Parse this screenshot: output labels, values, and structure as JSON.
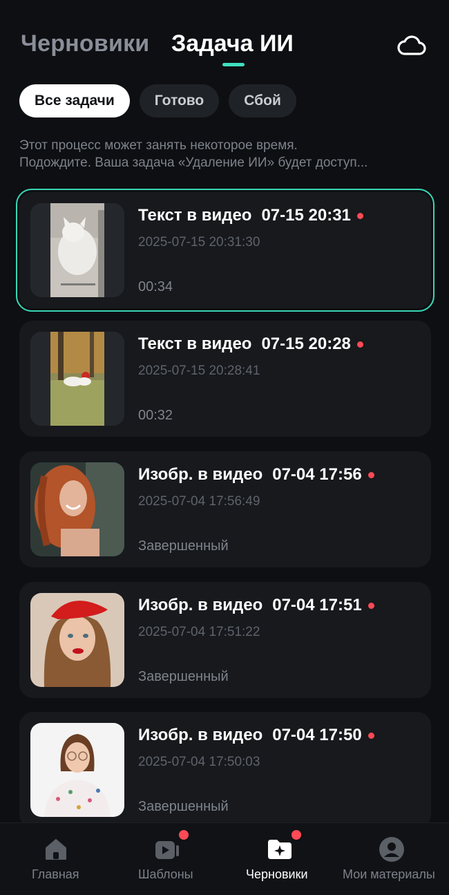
{
  "header": {
    "tab_drafts": "Черновики",
    "tab_ai_task": "Задача ИИ",
    "accent_color": "#3fe0c0"
  },
  "filters": {
    "all": "Все задачи",
    "done": "Готово",
    "failed": "Сбой"
  },
  "notice": {
    "line1": "Этот процесс может занять некоторое время.",
    "line2": "Подождите. Ваша задача «Удаление ИИ» будет доступ..."
  },
  "tasks": [
    {
      "type": "Текст в видео",
      "short_time": "07-15 20:31",
      "datetime": "2025-07-15 20:31:30",
      "meta": "00:34",
      "thumb": "cat-video",
      "unread": true
    },
    {
      "type": "Текст в видео",
      "short_time": "07-15 20:28",
      "datetime": "2025-07-15 20:28:41",
      "meta": "00:32",
      "thumb": "park-video",
      "unread": true
    },
    {
      "type": "Изобр. в видео",
      "short_time": "07-04 17:56",
      "datetime": "2025-07-04 17:56:49",
      "meta": "Завершенный",
      "thumb": "redhead-woman-photo",
      "unread": true
    },
    {
      "type": "Изобр. в видео",
      "short_time": "07-04 17:51",
      "datetime": "2025-07-04 17:51:22",
      "meta": "Завершенный",
      "thumb": "beret-woman-photo",
      "unread": true
    },
    {
      "type": "Изобр. в видео",
      "short_time": "07-04 17:50",
      "datetime": "2025-07-04 17:50:03",
      "meta": "Завершенный",
      "thumb": "glasses-woman-photo",
      "unread": true
    }
  ],
  "nav": {
    "home": "Главная",
    "templates": "Шаблоны",
    "drafts": "Черновики",
    "materials": "Мои материалы"
  },
  "colors": {
    "background": "#0d0f12",
    "card": "#17191d",
    "badge": "#ff4a55"
  }
}
